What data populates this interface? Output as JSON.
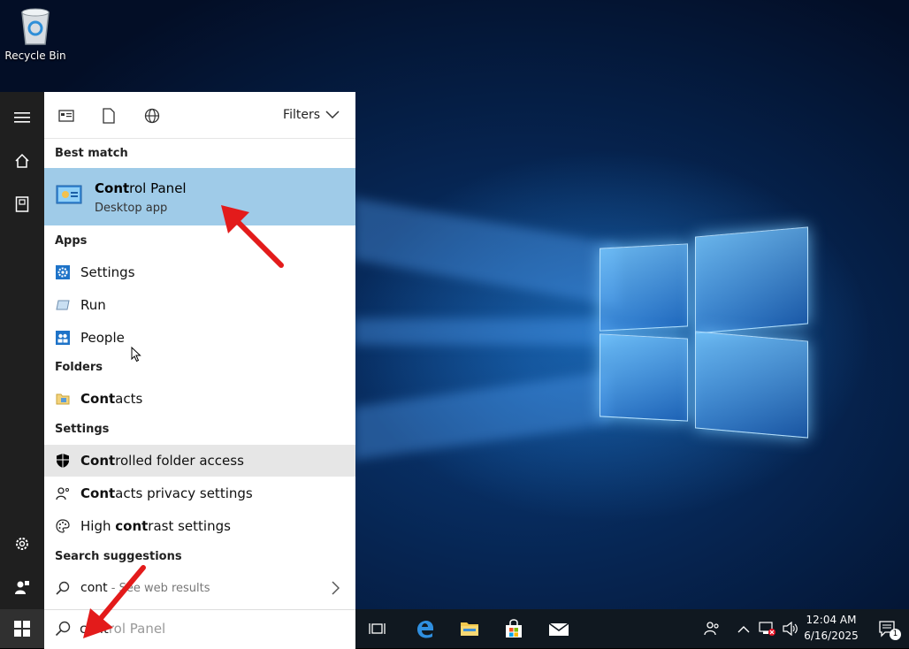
{
  "desktop": {
    "recycle_bin_label": "Recycle Bin"
  },
  "search": {
    "filters_label": "Filters",
    "best_match_header": "Best match",
    "best_match": {
      "title_bold": "Cont",
      "title_rest": "rol Panel",
      "subtitle": "Desktop app"
    },
    "apps_header": "Apps",
    "apps": [
      {
        "label": "Settings",
        "icon": "settings-icon"
      },
      {
        "label": "Run",
        "icon": "run-icon"
      },
      {
        "label": "People",
        "icon": "people-icon"
      }
    ],
    "folders_header": "Folders",
    "folders": [
      {
        "bold": "Cont",
        "rest": "acts",
        "icon": "contacts-folder-icon"
      }
    ],
    "settings_header": "Settings",
    "settings": [
      {
        "pre": "",
        "bold": "Cont",
        "rest": "rolled folder access",
        "icon": "shield-icon"
      },
      {
        "pre": "",
        "bold": "Cont",
        "rest": "acts privacy settings",
        "icon": "person-privacy-icon"
      },
      {
        "pre": "High ",
        "bold": "cont",
        "rest": "rast settings",
        "icon": "palette-icon"
      }
    ],
    "suggestions_header": "Search suggestions",
    "suggestion": {
      "query": "cont",
      "rest": " - See web results"
    },
    "input_typed": "cont",
    "input_ghost": "rol Panel"
  },
  "taskbar": {
    "time": "12:04 AM",
    "date": "6/16/2025",
    "notification_count": "1"
  }
}
